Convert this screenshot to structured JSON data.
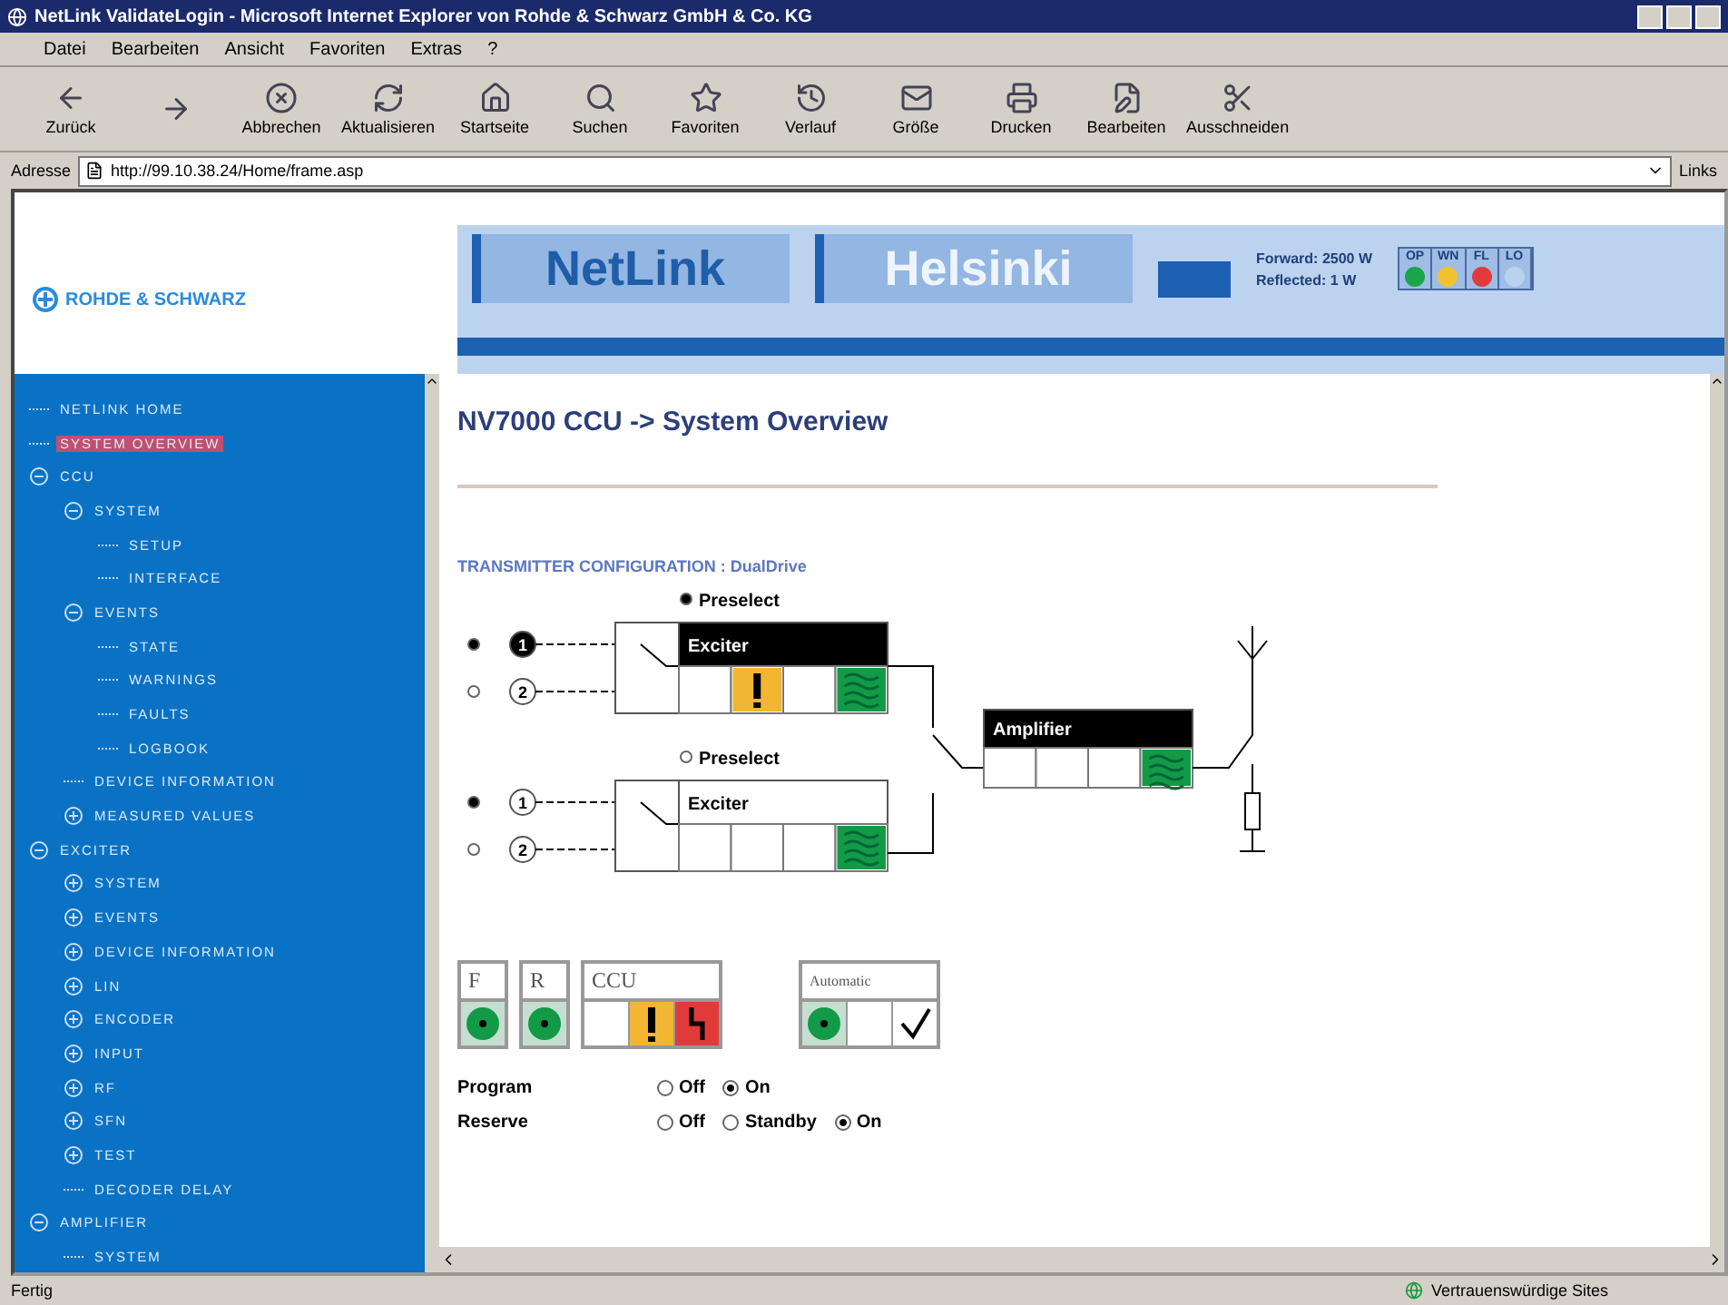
{
  "window": {
    "title": "NetLink ValidateLogin - Microsoft Internet Explorer von Rohde & Schwarz GmbH & Co. KG"
  },
  "menu": [
    "Datei",
    "Bearbeiten",
    "Ansicht",
    "Favoriten",
    "Extras",
    "?"
  ],
  "toolbar": [
    {
      "kind": "back",
      "label": "Zurück"
    },
    {
      "kind": "forward"
    },
    {
      "kind": "stop",
      "label": "Abbrechen"
    },
    {
      "kind": "refresh",
      "label": "Aktualisieren"
    },
    {
      "kind": "home",
      "label": "Startseite"
    },
    {
      "kind": "search",
      "label": "Suchen"
    },
    {
      "kind": "favorites",
      "label": "Favoriten"
    },
    {
      "kind": "history",
      "label": "Verlauf"
    },
    {
      "kind": "mail",
      "label": "Größe"
    },
    {
      "kind": "print",
      "label": "Drucken"
    },
    {
      "kind": "edit",
      "label": "Bearbeiten"
    },
    {
      "kind": "cut",
      "label": "Ausschneiden"
    }
  ],
  "address": {
    "label": "Adresse",
    "value": "http://99.10.38.24/Home/frame.asp",
    "links": "Links"
  },
  "logo": "ROHDE & SCHWARZ",
  "banner": {
    "tabs": [
      "NetLink",
      "Helsinki"
    ],
    "forward": "Forward: 2500 W",
    "reflected": "Reflected: 1 W",
    "lamps": [
      {
        "label": "OP",
        "color": "#1aa54a"
      },
      {
        "label": "WN",
        "color": "#f2c230"
      },
      {
        "label": "FL",
        "color": "#e23b3b"
      },
      {
        "label": "LO",
        "color": "#b9d3ee"
      }
    ]
  },
  "tree": [
    {
      "label": "NETLINK HOME",
      "kind": "page",
      "selected": false
    },
    {
      "label": "SYSTEM OVERVIEW",
      "kind": "page",
      "selected": true
    },
    {
      "label": "CCU",
      "kind": "folder",
      "expanded": true,
      "selected": false,
      "children": [
        {
          "label": "SYSTEM",
          "kind": "folder",
          "expanded": true,
          "selected": false,
          "children": [
            {
              "label": "SETUP",
              "kind": "page",
              "selected": false
            },
            {
              "label": "INTERFACE",
              "kind": "page",
              "selected": false
            }
          ]
        },
        {
          "label": "EVENTS",
          "kind": "folder",
          "expanded": true,
          "selected": false,
          "children": [
            {
              "label": "STATE",
              "kind": "page",
              "selected": false
            },
            {
              "label": "WARNINGS",
              "kind": "page",
              "selected": false
            },
            {
              "label": "FAULTS",
              "kind": "page",
              "selected": false
            },
            {
              "label": "LOGBOOK",
              "kind": "page",
              "selected": false
            }
          ]
        },
        {
          "label": "DEVICE INFORMATION",
          "kind": "page",
          "selected": false
        },
        {
          "label": "MEASURED VALUES",
          "kind": "folder",
          "expanded": false,
          "selected": false
        }
      ]
    },
    {
      "label": "EXCITER",
      "kind": "folder",
      "expanded": true,
      "selected": false,
      "children": [
        {
          "label": "SYSTEM",
          "kind": "folder",
          "expanded": false,
          "selected": false
        },
        {
          "label": "EVENTS",
          "kind": "folder",
          "expanded": false,
          "selected": false
        },
        {
          "label": "DEVICE INFORMATION",
          "kind": "folder",
          "expanded": false,
          "selected": false
        },
        {
          "label": "LIN",
          "kind": "folder",
          "expanded": false,
          "selected": false
        },
        {
          "label": "ENCODER",
          "kind": "folder",
          "expanded": false,
          "selected": false
        },
        {
          "label": "INPUT",
          "kind": "folder",
          "expanded": false,
          "selected": false
        },
        {
          "label": "RF",
          "kind": "folder",
          "expanded": false,
          "selected": false
        },
        {
          "label": "SFN",
          "kind": "folder",
          "expanded": false,
          "selected": false
        },
        {
          "label": "TEST",
          "kind": "folder",
          "expanded": false,
          "selected": false
        },
        {
          "label": "DECODER DELAY",
          "kind": "page",
          "selected": false
        }
      ]
    },
    {
      "label": "AMPLIFIER",
      "kind": "folder",
      "expanded": true,
      "selected": false,
      "children": [
        {
          "label": "SYSTEM",
          "kind": "page",
          "selected": false
        }
      ]
    }
  ],
  "page_title": "NV7000 CCU -> System Overview",
  "config_label": "TRANSMITTER CONFIGURATION : DualDrive",
  "exciters": [
    {
      "preselect": "Preselect",
      "preselected": true,
      "title": "Exciter",
      "active": true,
      "inputs": [
        {
          "label": "1",
          "selected": true,
          "active": true
        },
        {
          "label": "2",
          "selected": false,
          "active": false
        }
      ],
      "cells": [
        {
          "kind": "empty"
        },
        {
          "kind": "warning"
        },
        {
          "kind": "empty"
        },
        {
          "kind": "rf"
        }
      ]
    },
    {
      "preselect": "Preselect",
      "preselected": false,
      "title": "Exciter",
      "active": false,
      "inputs": [
        {
          "label": "1",
          "selected": true,
          "active": false
        },
        {
          "label": "2",
          "selected": false,
          "active": false
        }
      ],
      "cells": [
        {
          "kind": "empty"
        },
        {
          "kind": "empty"
        },
        {
          "kind": "empty"
        },
        {
          "kind": "rf"
        }
      ]
    }
  ],
  "amplifier": {
    "title": "Amplifier",
    "active": true,
    "cells": [
      {
        "kind": "empty"
      },
      {
        "kind": "empty"
      },
      {
        "kind": "empty"
      },
      {
        "kind": "rf"
      }
    ]
  },
  "indicators": [
    {
      "title": "F",
      "cells": [
        {
          "kind": "led"
        }
      ]
    },
    {
      "title": "R",
      "cells": [
        {
          "kind": "led"
        }
      ]
    },
    {
      "title": "CCU",
      "cells": [
        {
          "kind": "empty"
        },
        {
          "kind": "warning"
        },
        {
          "kind": "fault"
        }
      ]
    },
    {
      "title": "Automatic",
      "cells": [
        {
          "kind": "led"
        },
        {
          "kind": "empty"
        },
        {
          "kind": "check"
        }
      ]
    }
  ],
  "switches": [
    {
      "label": "Program",
      "options": [
        {
          "label": "Off",
          "selected": false
        },
        {
          "label": "On",
          "selected": true
        }
      ]
    },
    {
      "label": "Reserve",
      "options": [
        {
          "label": "Off",
          "selected": false
        },
        {
          "label": "Standby",
          "selected": false
        },
        {
          "label": "On",
          "selected": true
        }
      ]
    }
  ],
  "status": {
    "text": "Fertig",
    "zone": "Vertrauenswürdige Sites"
  }
}
